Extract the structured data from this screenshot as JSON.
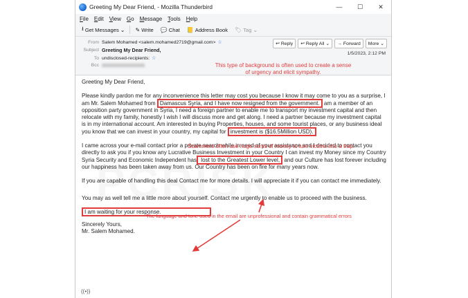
{
  "window": {
    "title": "Greeting My Dear Friend, - Mozilla Thunderbird",
    "controls": [
      "—",
      "☐",
      "✕"
    ]
  },
  "menu": [
    "File",
    "Edit",
    "View",
    "Go",
    "Message",
    "Tools",
    "Help"
  ],
  "toolbar": {
    "get_messages": "Get Messages",
    "write": "Write",
    "chat": "Chat",
    "address_book": "Address Book",
    "tag": "Tag"
  },
  "header": {
    "from_label": "From",
    "from_value": "Salem Mohamed <salem.mohamed2719@gmail.com>",
    "subject_label": "Subject",
    "subject_value": "Greeting My Dear Friend,",
    "to_label": "To",
    "to_value": "undisclosed-recipients:",
    "bcc_label": "Bcc",
    "date": "1/5/2023, 2:12 PM",
    "actions": {
      "reply": "Reply",
      "reply_all": "Reply All",
      "forward": "Forward",
      "more": "More"
    }
  },
  "email": {
    "greeting": "Greeting My Dear Friend,",
    "p1_a": "Please kindly pardon me for any inconvenience this letter may cost you because I know it may come to you as a surprise, I am Mr. Salem Mohamed from ",
    "p1_hl1": "Damascus Syria, and I have now resigned from the government.",
    "p1_b": " am a member of an opposition party government in Syria, I need a foreign partner to enable me to transport my investment capital and then relocate with my family, honestly I wish I will discuss more and get along. I need a partner because my investment capital is in my international account. Am interested in buying Properties, houses, and some tourist places, or any business ideal you know that we can invest in your country, my capital for ",
    "p1_hl2": "investment is ($16.5Million USD).",
    "p2_a": "I came across your e-mail contact prior a private search while in need of your assistance and I decided to contact you directly to ask you if you know any Lucrative Business Investment in your Country I can invest my Money since my Country Syria Security and Economic Independent has",
    "p2_hl": " lost to the Greatest Lower level,",
    "p2_b": " and our Culture has lost forever including our happiness has been taken away from us. Our Country has been on fire for many years now.",
    "p3": "If you are capable of handling this deal Contact me for more details. I will appreciate it if you can contact me immediately.",
    "p4": "You may as well tell me a little more about yourself. Contact me urgently to enable us to proceed with the business.",
    "p5_hl": "I am waiting for your response.",
    "sign1": "Sincerely Yours,",
    "sign2": "Mr. Salem Mohamed."
  },
  "annotations": {
    "note1": "This type of background is often used to create a sense of urgency and elicit sympathy.",
    "note2": "Scammers often use huge sums of money to lure victims into a trap.",
    "note3": "The language and tone used in the email are unprofessional and contain grammatical errors",
    "color": "#e23b3b"
  },
  "watermark": "PCRISK"
}
